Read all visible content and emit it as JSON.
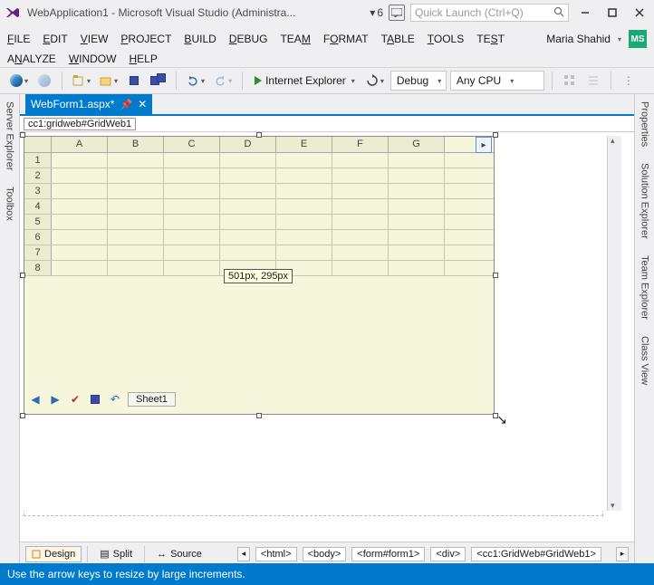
{
  "title": "WebApplication1 - Microsoft Visual Studio (Administra...",
  "flag_count": "6",
  "quicklaunch_placeholder": "Quick Launch (Ctrl+Q)",
  "user": {
    "name": "Maria Shahid",
    "initials": "MS"
  },
  "menus_row1": [
    "FILE",
    "EDIT",
    "VIEW",
    "PROJECT",
    "BUILD",
    "DEBUG",
    "TEAM",
    "FORMAT",
    "TABLE",
    "TOOLS",
    "TEST"
  ],
  "menus_row2": [
    "ANALYZE",
    "WINDOW",
    "HELP"
  ],
  "toolbar": {
    "run_label": "Internet Explorer",
    "config": "Debug",
    "platform": "Any CPU"
  },
  "tab": {
    "name": "WebForm1.aspx*",
    "pinned": true
  },
  "selector": "cc1:gridweb#GridWeb1",
  "grid": {
    "columns": [
      "A",
      "B",
      "C",
      "D",
      "E",
      "F",
      "G"
    ],
    "rows": [
      "1",
      "2",
      "3",
      "4",
      "5",
      "6",
      "7",
      "8"
    ],
    "size_tooltip": "501px, 295px",
    "sheet": "Sheet1"
  },
  "view_switch": {
    "design": "Design",
    "split": "Split",
    "source": "Source"
  },
  "breadcrumbs": [
    "<html>",
    "<body>",
    "<form#form1>",
    "<div>",
    "<cc1:GridWeb#GridWeb1>"
  ],
  "status": "Use the arrow keys to resize by large increments.",
  "right_panels": [
    "Properties",
    "Solution Explorer",
    "Team Explorer",
    "Class View"
  ],
  "left_panels": [
    "Server Explorer",
    "Toolbox"
  ]
}
